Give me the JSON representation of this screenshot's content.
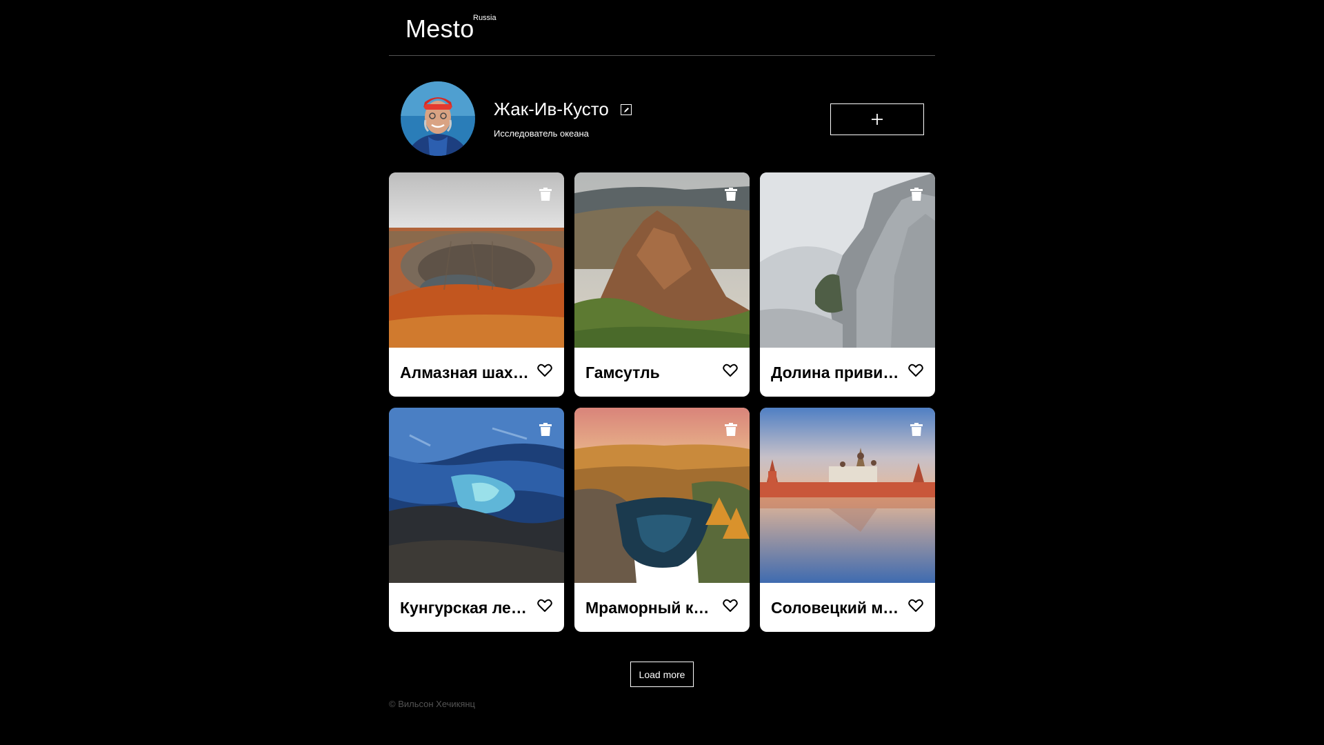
{
  "header": {
    "logo": "Mesto",
    "logo_region": "Russia"
  },
  "profile": {
    "name": "Жак-Ив-Кусто",
    "about": "Исследователь океана"
  },
  "cards": [
    {
      "title": "Алмазная шахта Мир"
    },
    {
      "title": "Гамсутль"
    },
    {
      "title": "Долина привидений"
    },
    {
      "title": "Кунгурская ледяная пещера"
    },
    {
      "title": "Мраморный каньон"
    },
    {
      "title": "Соловецкий монастырь"
    }
  ],
  "load_more": "Load more",
  "footer": {
    "copyright": "© Вильсон Хечикянц"
  }
}
